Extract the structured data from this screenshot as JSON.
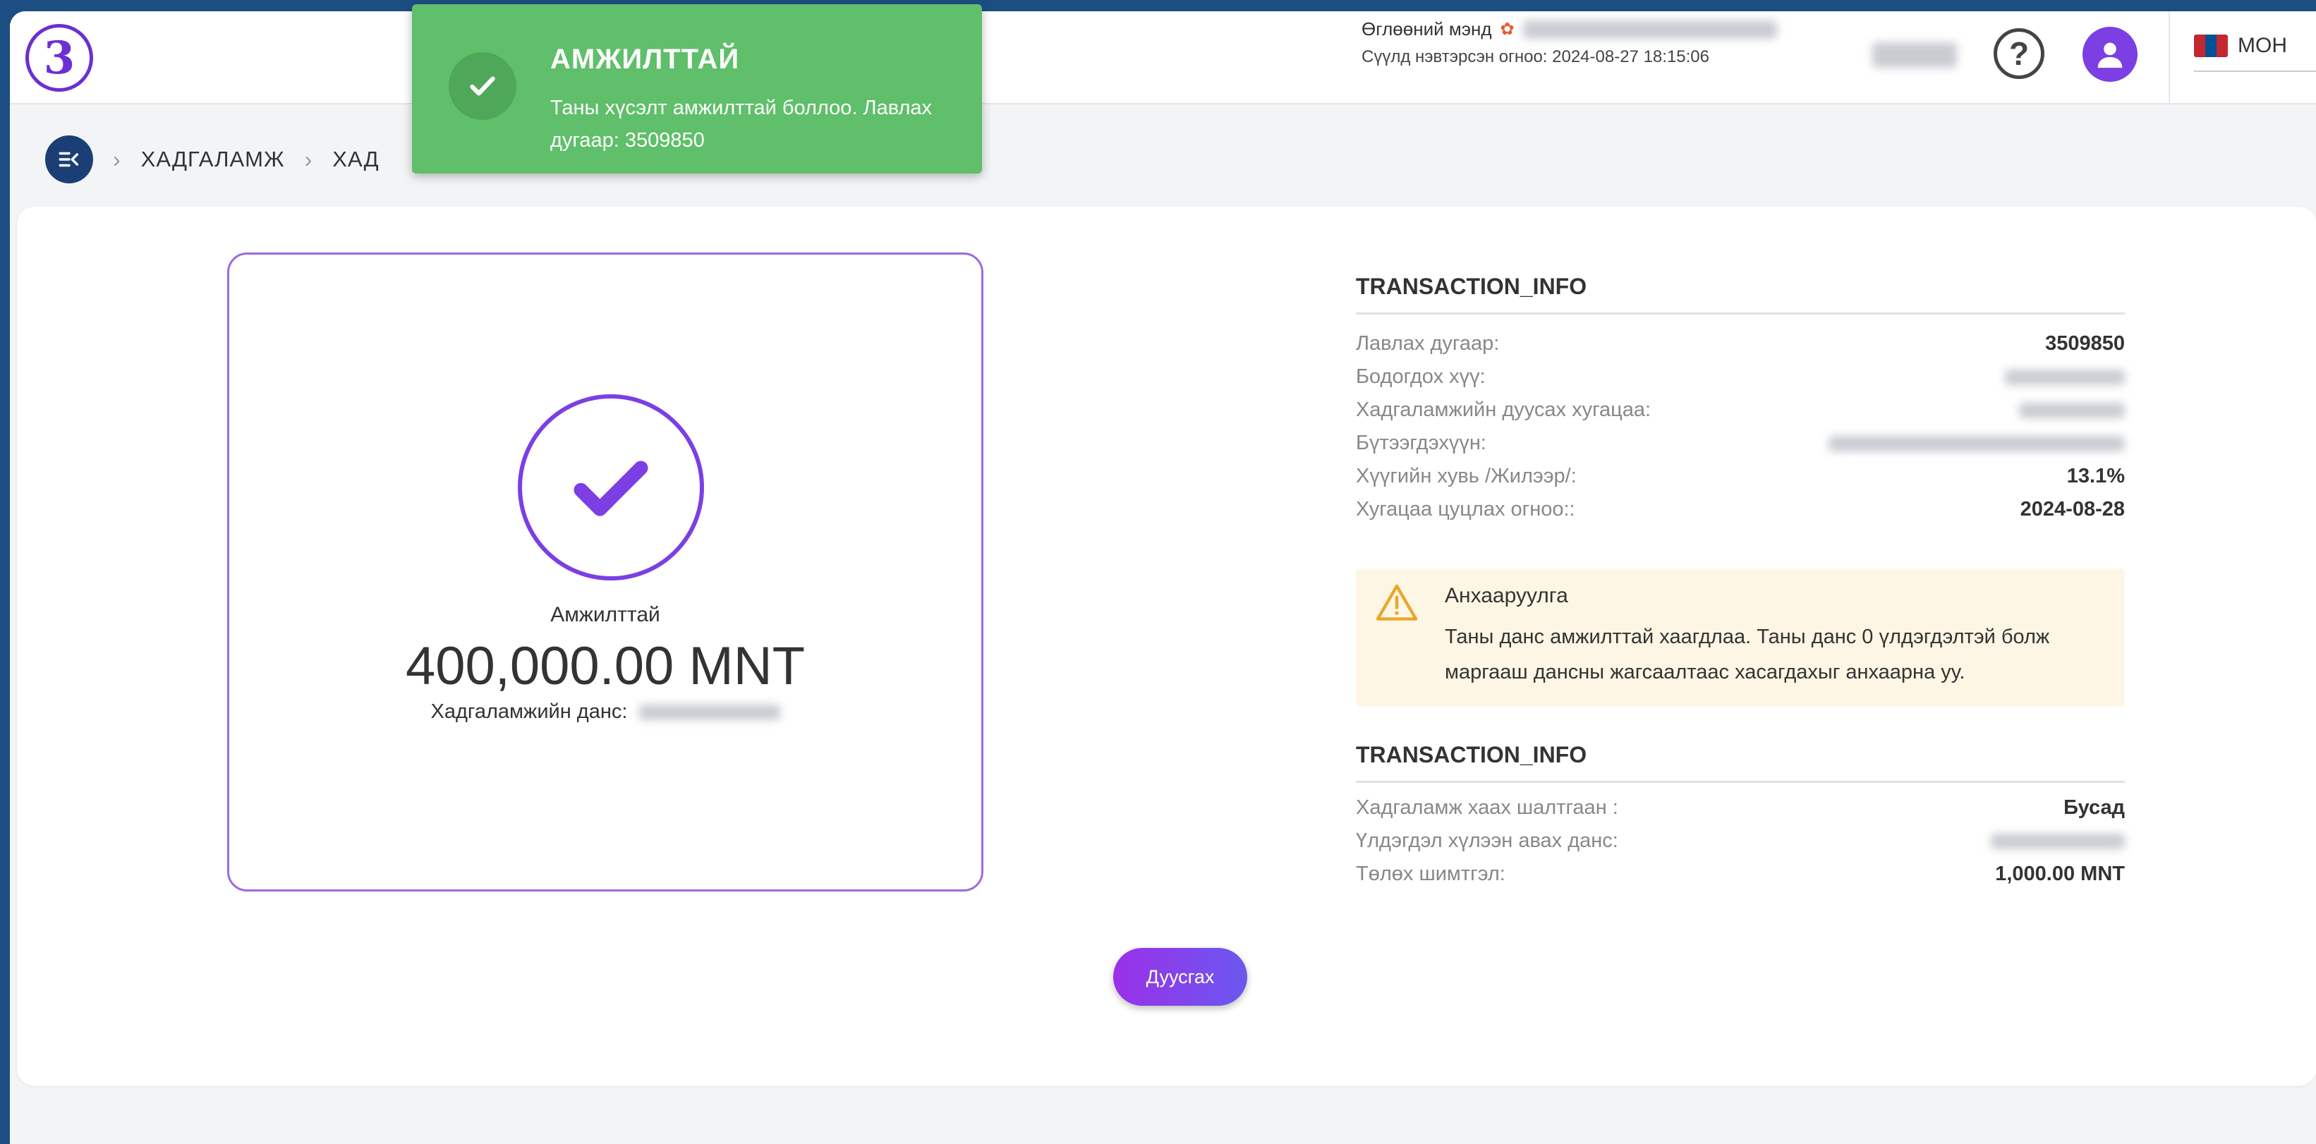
{
  "header": {
    "step_number": "3",
    "greeting": "Өглөөний мэнд",
    "last_login": "Сүүлд нэвтэрсэн огноо: 2024-08-27 18:15:06",
    "language": "МОН"
  },
  "toast": {
    "title": "АМЖИЛТТАЙ",
    "message": "Таны хүсэлт амжилттай боллоо. Лавлах дугаар: 3509850"
  },
  "breadcrumb": [
    "ХАДГАЛАМЖ",
    "ХАД"
  ],
  "success_box": {
    "label": "Амжилттай",
    "amount": "400,000.00 MNT",
    "account_label": "Хадгаламжийн данс:"
  },
  "transaction_info": {
    "title": "TRANSACTION_INFO",
    "rows": [
      {
        "label": "Лавлах дугаар:",
        "value": "3509850"
      },
      {
        "label": "Бодогдох хүү:",
        "value": ""
      },
      {
        "label": "Хадгаламжийн дуусах хугацаа:",
        "value": ""
      },
      {
        "label": "Бүтээгдэхүүн:",
        "value": ""
      },
      {
        "label": "Хүүгийн хувь /Жилээр/:",
        "value": "13.1%"
      },
      {
        "label": "Хугацаа цуцлах огноо::",
        "value": "2024-08-28"
      }
    ]
  },
  "notice": {
    "title": "Анхааруулга",
    "text": "Таны данс амжилттай хаагдлаа. Таны данс 0 үлдэгдэлтэй болж маргааш дансны жагсаалтаас хасагдахыг анхаарна уу."
  },
  "transaction_info_2": {
    "title": "TRANSACTION_INFO",
    "rows": [
      {
        "label": "Хадгаламж хаах шалтгаан :",
        "value": "Бусад"
      },
      {
        "label": "Үлдэгдэл хүлээн авах данс:",
        "value": ""
      },
      {
        "label": "Төлөх шимтгэл:",
        "value": "1,000.00 MNT"
      }
    ]
  },
  "actions": {
    "finish_label": "Дуусгах"
  },
  "colors": {
    "brand_navy": "#1d4e82",
    "accent_purple": "#7b3fe4",
    "success_green": "#5fbf6a"
  }
}
